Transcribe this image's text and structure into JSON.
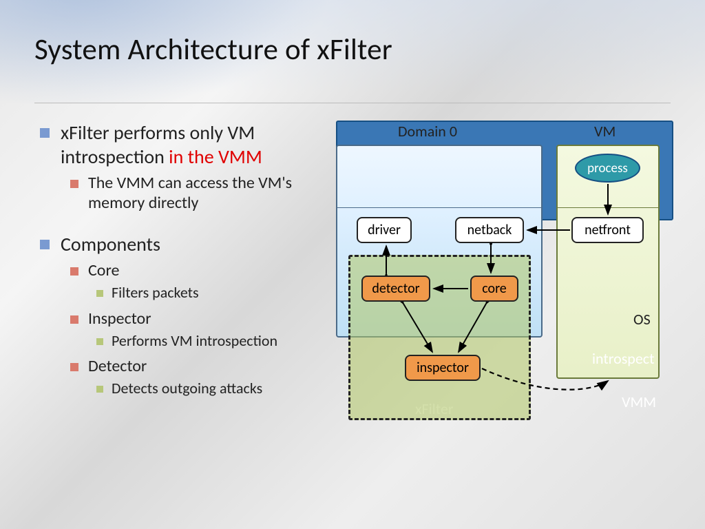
{
  "slide": {
    "title": "System Architecture of xFilter"
  },
  "bullets": {
    "p1_text": "xFilter performs only VM introspection ",
    "p1_em": "in the VMM",
    "p1_sub": "The VMM can access the VM's memory directly",
    "p2": "Components",
    "c1": "Core",
    "c1s": "Filters packets",
    "c2": "Inspector",
    "c2s": "Performs VM introspection",
    "c3": "Detector",
    "c3s": "Detects outgoing attacks"
  },
  "diagram": {
    "domain0": "Domain 0",
    "vm": "VM",
    "os": "OS",
    "vmm": "VMM",
    "xfilter": "xFilter",
    "introspect": "introspect",
    "process": "process",
    "driver": "driver",
    "netback": "netback",
    "netfront": "netfront",
    "detector": "detector",
    "core": "core",
    "inspector": "inspector"
  }
}
